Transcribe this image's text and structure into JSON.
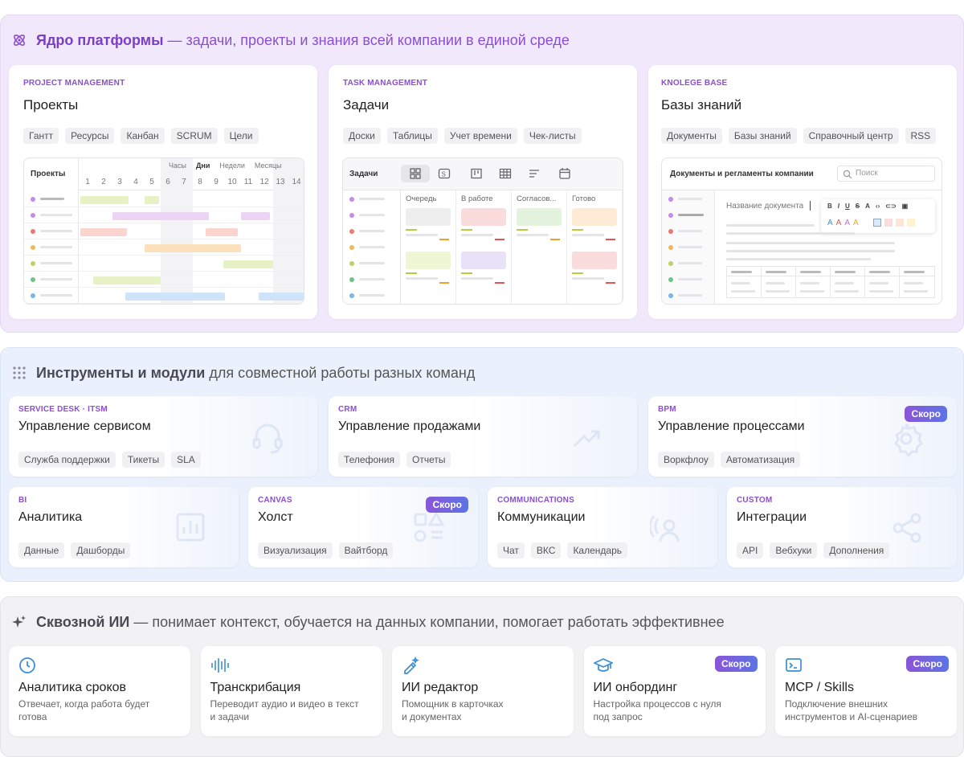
{
  "core": {
    "title_bold": "Ядро платформы",
    "title_rest": "— задачи, проекты и знания всей компании в единой среде",
    "cards": [
      {
        "category": "PROJECT MANAGEMENT",
        "title": "Проекты",
        "tags": [
          "Гантт",
          "Ресурсы",
          "Канбан",
          "SCRUM",
          "Цели"
        ]
      },
      {
        "category": "TASK MANAGEMENT",
        "title": "Задачи",
        "tags": [
          "Доски",
          "Таблицы",
          "Учет времени",
          "Чек-листы"
        ]
      },
      {
        "category": "KNOLEGE BASE",
        "title": "Базы знаний",
        "tags": [
          "Документы",
          "Базы знаний",
          "Справочный центр",
          "RSS"
        ]
      }
    ],
    "gantt": {
      "label": "Проекты",
      "scales": [
        "Часы",
        "Дни",
        "Недели",
        "Месяцы"
      ],
      "days": [
        "1",
        "2",
        "3",
        "4",
        "5",
        "6",
        "7",
        "8",
        "9",
        "10",
        "11",
        "12",
        "13",
        "14"
      ]
    },
    "kanban": {
      "label": "Задачи",
      "columns": [
        "Очередь",
        "В работе",
        "Согласов...",
        "Готово"
      ]
    },
    "kb": {
      "label": "Документы и регламенты компании",
      "search_placeholder": "Поиск",
      "doc_title": "Название документа"
    }
  },
  "tools": {
    "title_bold": "Инструменты и модули",
    "title_rest": "для совместной работы разных команд",
    "soon": "Скоро",
    "row1": [
      {
        "category": "SERVICE DESK · ITSM",
        "title": "Управление сервисом",
        "tags": [
          "Служба поддержки",
          "Тикеты",
          "SLA"
        ],
        "icon": "headset-icon",
        "soon": false
      },
      {
        "category": "CRM",
        "title": "Управление продажами",
        "tags": [
          "Телефония",
          "Отчеты"
        ],
        "icon": "trend-up-icon",
        "soon": false
      },
      {
        "category": "BPM",
        "title": "Управление процессами",
        "tags": [
          "Воркфлоу",
          "Автоматизация"
        ],
        "icon": "gear-icon",
        "soon": true
      }
    ],
    "row2": [
      {
        "category": "BI",
        "title": "Аналитика",
        "tags": [
          "Данные",
          "Дашборды"
        ],
        "icon": "chart-icon",
        "soon": false
      },
      {
        "category": "CANVAS",
        "title": "Холст",
        "tags": [
          "Визуализация",
          "Вайтборд"
        ],
        "icon": "shapes-icon",
        "soon": true
      },
      {
        "category": "COMMUNICATIONS",
        "title": "Коммуникации",
        "tags": [
          "Чат",
          "ВКС",
          "Календарь"
        ],
        "icon": "broadcast-user-icon",
        "soon": false
      },
      {
        "category": "CUSTOM",
        "title": "Интеграции",
        "tags": [
          "API",
          "Вебхуки",
          "Дополнения"
        ],
        "icon": "share-icon",
        "soon": false
      }
    ]
  },
  "ai": {
    "title_bold": "Сквозной ИИ",
    "title_rest": "— понимает контекст, обучается на данных компании, помогает работать эффективнее",
    "soon": "Скоро",
    "cards": [
      {
        "title": "Аналитика сроков",
        "desc1": "Отвечает, когда работа будет",
        "desc2": "готова",
        "icon": "clock-icon",
        "soon": false
      },
      {
        "title": "Транскрибация",
        "desc1": "Переводит аудио и видео в текст",
        "desc2": "и задачи",
        "icon": "waveform-icon",
        "soon": false
      },
      {
        "title": "ИИ редактор",
        "desc1": "Помощник в карточках",
        "desc2": "и документах",
        "icon": "magic-pen-icon",
        "soon": false
      },
      {
        "title": "ИИ онбординг",
        "desc1": "Настройка процессов с нуля",
        "desc2": "под запрос",
        "icon": "graduation-cap-icon",
        "soon": true
      },
      {
        "title": "MCP / Skills",
        "desc1": "Подключение внешних",
        "desc2": "инструментов и AI-сценариев",
        "icon": "terminal-icon",
        "soon": true
      }
    ]
  },
  "colors": {
    "accent": "#8a4fcf",
    "badge_start": "#8a55d8",
    "badge_end": "#5c74e4",
    "ai_icon": "#3a8fd8"
  }
}
